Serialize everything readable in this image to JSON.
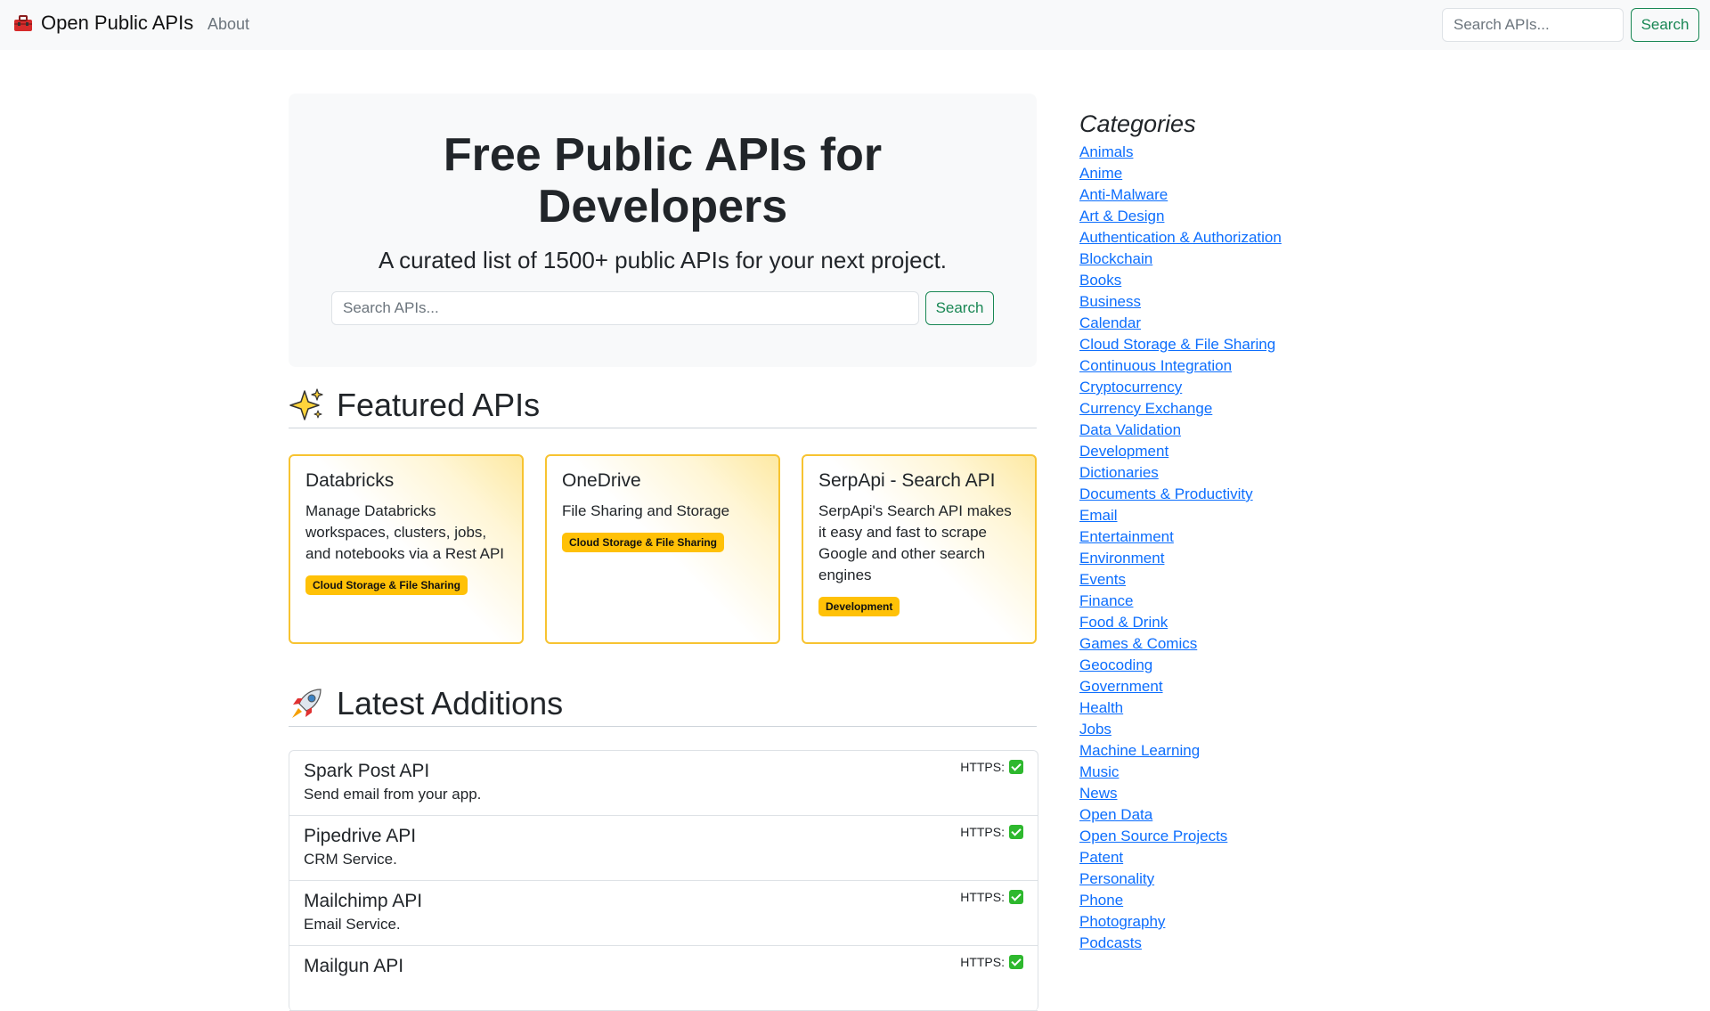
{
  "navbar": {
    "brand": "Open Public APIs",
    "about": "About",
    "search_placeholder": "Search APIs...",
    "search_button": "Search"
  },
  "hero": {
    "title_line1": "Free Public APIs for",
    "title_line2": "Developers",
    "subtitle": "A curated list of 1500+ public APIs for your next project.",
    "search_placeholder": "Search APIs...",
    "search_button": "Search"
  },
  "featured": {
    "heading": "Featured APIs",
    "cards": [
      {
        "title": "Databricks",
        "description": "Manage Databricks workspaces, clusters, jobs, and notebooks via a Rest API",
        "badge": "Cloud Storage & File Sharing"
      },
      {
        "title": "OneDrive",
        "description": "File Sharing and Storage",
        "badge": "Cloud Storage & File Sharing"
      },
      {
        "title": "SerpApi - Search API",
        "description": "SerpApi's Search API makes it easy and fast to scrape Google and other search engines",
        "badge": "Development"
      }
    ]
  },
  "latest": {
    "heading": "Latest Additions",
    "https_label": "HTTPS:",
    "items": [
      {
        "name": "Spark Post API",
        "description": "Send email from your app."
      },
      {
        "name": "Pipedrive API",
        "description": "CRM Service."
      },
      {
        "name": "Mailchimp API",
        "description": "Email Service."
      },
      {
        "name": "Mailgun API",
        "description": ""
      }
    ]
  },
  "sidebar": {
    "title": "Categories",
    "categories": [
      "Animals",
      "Anime",
      "Anti-Malware",
      "Art & Design",
      "Authentication & Authorization",
      "Blockchain",
      "Books",
      "Business",
      "Calendar",
      "Cloud Storage & File Sharing",
      "Continuous Integration",
      "Cryptocurrency",
      "Currency Exchange",
      "Data Validation",
      "Development",
      "Dictionaries",
      "Documents & Productivity",
      "Email",
      "Entertainment",
      "Environment",
      "Events",
      "Finance",
      "Food & Drink",
      "Games & Comics",
      "Geocoding",
      "Government",
      "Health",
      "Jobs",
      "Machine Learning",
      "Music",
      "News",
      "Open Data",
      "Open Source Projects",
      "Patent",
      "Personality",
      "Phone",
      "Photography",
      "Podcasts"
    ]
  },
  "colors": {
    "accent_green": "#198754",
    "link_blue": "#0d6efd",
    "badge_yellow": "#ffc107",
    "card_border": "#f7c331"
  },
  "icons": {
    "brand": "toolbox-icon",
    "featured": "sparkles-icon",
    "latest": "rocket-icon",
    "https": "check-icon"
  }
}
